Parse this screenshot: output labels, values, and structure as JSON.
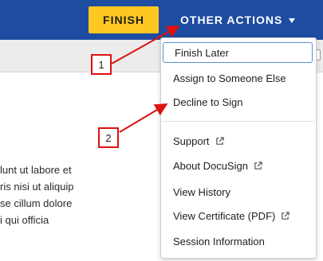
{
  "header": {
    "finish_label": "FINISH",
    "other_actions_label": "OTHER ACTIONS"
  },
  "document": {
    "lines": [
      "lunt ut labore et",
      "ris nisi ut aliquip",
      "se cillum dolore",
      "i qui officia"
    ]
  },
  "menu": {
    "items": [
      {
        "label": "Finish Later",
        "external": false
      },
      {
        "label": "Assign to Someone Else",
        "external": false
      },
      {
        "label": "Decline to Sign",
        "external": false
      },
      {
        "label": "Support",
        "external": true
      },
      {
        "label": "About DocuSign",
        "external": true
      },
      {
        "label": "View History",
        "external": false
      },
      {
        "label": "View Certificate (PDF)",
        "external": true
      },
      {
        "label": "Session Information",
        "external": false
      }
    ]
  },
  "callouts": [
    "1",
    "2"
  ],
  "colors": {
    "header_bg": "#1e4ca1",
    "finish_bg": "#ffc820",
    "callout": "#dd1111"
  },
  "icons": [
    "caret-down-icon",
    "external-link-icon"
  ]
}
